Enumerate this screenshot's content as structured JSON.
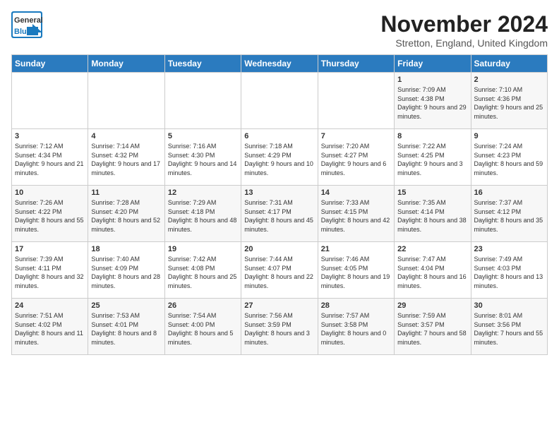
{
  "logo": {
    "general": "General",
    "blue": "Blue"
  },
  "title": "November 2024",
  "location": "Stretton, England, United Kingdom",
  "headers": [
    "Sunday",
    "Monday",
    "Tuesday",
    "Wednesday",
    "Thursday",
    "Friday",
    "Saturday"
  ],
  "weeks": [
    [
      {
        "day": "",
        "info": ""
      },
      {
        "day": "",
        "info": ""
      },
      {
        "day": "",
        "info": ""
      },
      {
        "day": "",
        "info": ""
      },
      {
        "day": "",
        "info": ""
      },
      {
        "day": "1",
        "info": "Sunrise: 7:09 AM\nSunset: 4:38 PM\nDaylight: 9 hours and 29 minutes."
      },
      {
        "day": "2",
        "info": "Sunrise: 7:10 AM\nSunset: 4:36 PM\nDaylight: 9 hours and 25 minutes."
      }
    ],
    [
      {
        "day": "3",
        "info": "Sunrise: 7:12 AM\nSunset: 4:34 PM\nDaylight: 9 hours and 21 minutes."
      },
      {
        "day": "4",
        "info": "Sunrise: 7:14 AM\nSunset: 4:32 PM\nDaylight: 9 hours and 17 minutes."
      },
      {
        "day": "5",
        "info": "Sunrise: 7:16 AM\nSunset: 4:30 PM\nDaylight: 9 hours and 14 minutes."
      },
      {
        "day": "6",
        "info": "Sunrise: 7:18 AM\nSunset: 4:29 PM\nDaylight: 9 hours and 10 minutes."
      },
      {
        "day": "7",
        "info": "Sunrise: 7:20 AM\nSunset: 4:27 PM\nDaylight: 9 hours and 6 minutes."
      },
      {
        "day": "8",
        "info": "Sunrise: 7:22 AM\nSunset: 4:25 PM\nDaylight: 9 hours and 3 minutes."
      },
      {
        "day": "9",
        "info": "Sunrise: 7:24 AM\nSunset: 4:23 PM\nDaylight: 8 hours and 59 minutes."
      }
    ],
    [
      {
        "day": "10",
        "info": "Sunrise: 7:26 AM\nSunset: 4:22 PM\nDaylight: 8 hours and 55 minutes."
      },
      {
        "day": "11",
        "info": "Sunrise: 7:28 AM\nSunset: 4:20 PM\nDaylight: 8 hours and 52 minutes."
      },
      {
        "day": "12",
        "info": "Sunrise: 7:29 AM\nSunset: 4:18 PM\nDaylight: 8 hours and 48 minutes."
      },
      {
        "day": "13",
        "info": "Sunrise: 7:31 AM\nSunset: 4:17 PM\nDaylight: 8 hours and 45 minutes."
      },
      {
        "day": "14",
        "info": "Sunrise: 7:33 AM\nSunset: 4:15 PM\nDaylight: 8 hours and 42 minutes."
      },
      {
        "day": "15",
        "info": "Sunrise: 7:35 AM\nSunset: 4:14 PM\nDaylight: 8 hours and 38 minutes."
      },
      {
        "day": "16",
        "info": "Sunrise: 7:37 AM\nSunset: 4:12 PM\nDaylight: 8 hours and 35 minutes."
      }
    ],
    [
      {
        "day": "17",
        "info": "Sunrise: 7:39 AM\nSunset: 4:11 PM\nDaylight: 8 hours and 32 minutes."
      },
      {
        "day": "18",
        "info": "Sunrise: 7:40 AM\nSunset: 4:09 PM\nDaylight: 8 hours and 28 minutes."
      },
      {
        "day": "19",
        "info": "Sunrise: 7:42 AM\nSunset: 4:08 PM\nDaylight: 8 hours and 25 minutes."
      },
      {
        "day": "20",
        "info": "Sunrise: 7:44 AM\nSunset: 4:07 PM\nDaylight: 8 hours and 22 minutes."
      },
      {
        "day": "21",
        "info": "Sunrise: 7:46 AM\nSunset: 4:05 PM\nDaylight: 8 hours and 19 minutes."
      },
      {
        "day": "22",
        "info": "Sunrise: 7:47 AM\nSunset: 4:04 PM\nDaylight: 8 hours and 16 minutes."
      },
      {
        "day": "23",
        "info": "Sunrise: 7:49 AM\nSunset: 4:03 PM\nDaylight: 8 hours and 13 minutes."
      }
    ],
    [
      {
        "day": "24",
        "info": "Sunrise: 7:51 AM\nSunset: 4:02 PM\nDaylight: 8 hours and 11 minutes."
      },
      {
        "day": "25",
        "info": "Sunrise: 7:53 AM\nSunset: 4:01 PM\nDaylight: 8 hours and 8 minutes."
      },
      {
        "day": "26",
        "info": "Sunrise: 7:54 AM\nSunset: 4:00 PM\nDaylight: 8 hours and 5 minutes."
      },
      {
        "day": "27",
        "info": "Sunrise: 7:56 AM\nSunset: 3:59 PM\nDaylight: 8 hours and 3 minutes."
      },
      {
        "day": "28",
        "info": "Sunrise: 7:57 AM\nSunset: 3:58 PM\nDaylight: 8 hours and 0 minutes."
      },
      {
        "day": "29",
        "info": "Sunrise: 7:59 AM\nSunset: 3:57 PM\nDaylight: 7 hours and 58 minutes."
      },
      {
        "day": "30",
        "info": "Sunrise: 8:01 AM\nSunset: 3:56 PM\nDaylight: 7 hours and 55 minutes."
      }
    ]
  ]
}
